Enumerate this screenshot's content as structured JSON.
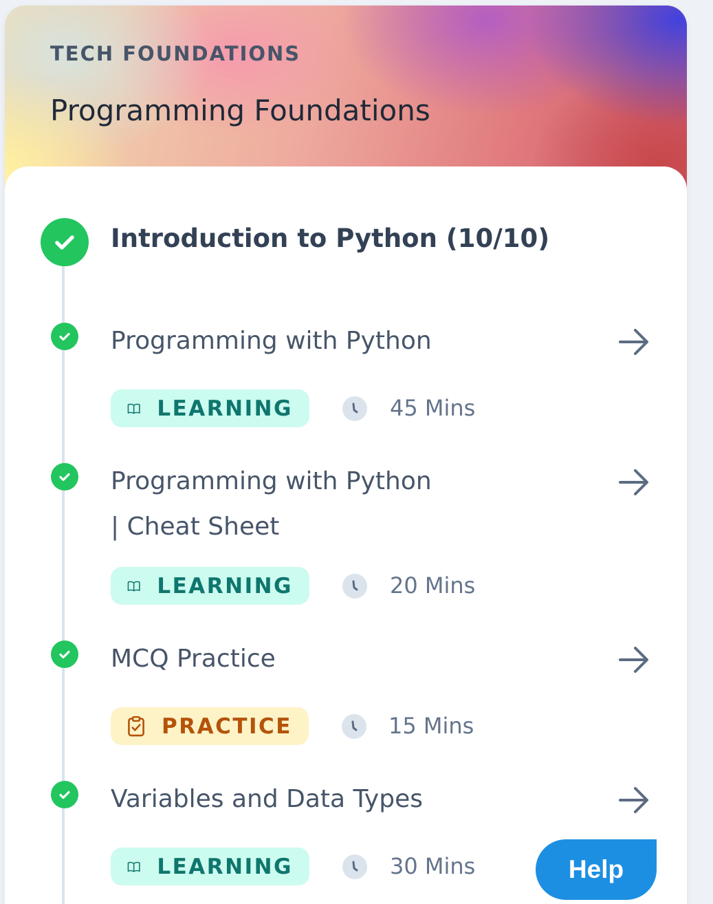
{
  "course": {
    "overline": "TECH FOUNDATIONS",
    "title": "Programming Foundations"
  },
  "module": {
    "title": "Introduction to Python (10/10)",
    "completed": true
  },
  "items": [
    {
      "title_lines": [
        "Programming with Python"
      ],
      "completed": true,
      "type_label": "LEARNING",
      "type_icon": "book-icon",
      "duration": "45 Mins"
    },
    {
      "title_lines": [
        "Programming with Python",
        "| Cheat Sheet"
      ],
      "completed": true,
      "type_label": "LEARNING",
      "type_icon": "book-icon",
      "duration": "20 Mins"
    },
    {
      "title_lines": [
        "MCQ Practice"
      ],
      "completed": true,
      "type_label": "PRACTICE",
      "type_icon": "clipboard-check-icon",
      "duration": "15 Mins"
    },
    {
      "title_lines": [
        "Variables and Data Types"
      ],
      "completed": true,
      "type_label": "LEARNING",
      "type_icon": "book-icon",
      "duration": "30 Mins"
    }
  ],
  "help": {
    "label": "Help"
  },
  "colors": {
    "complete": "#22c55e",
    "learning_bg": "#ccfbef",
    "learning_text": "#0f766e",
    "practice_bg": "#fef3c7",
    "practice_text": "#b45309",
    "help_button": "#1d8fe2"
  }
}
